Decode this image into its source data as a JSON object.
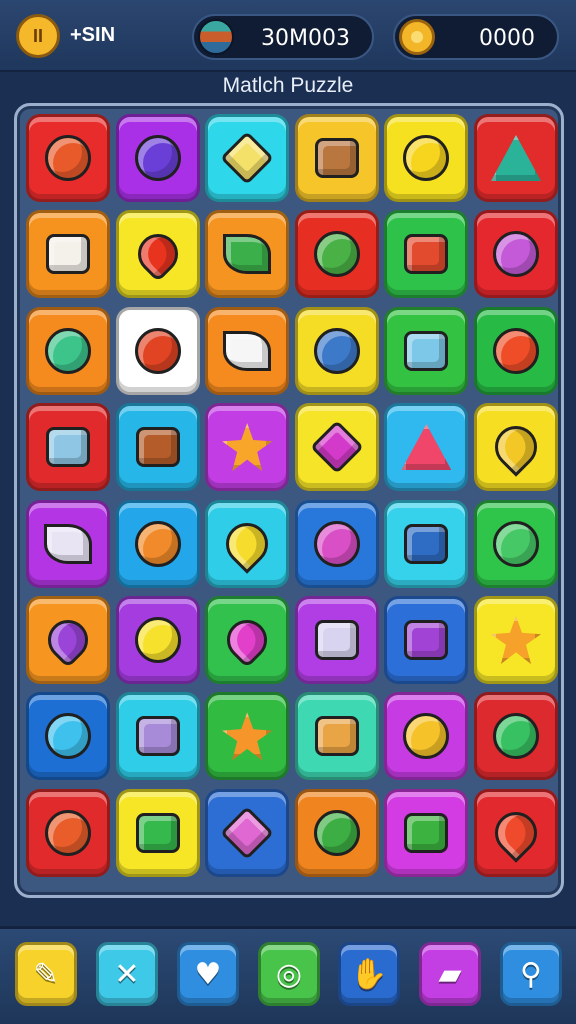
{
  "hud": {
    "pause_label": "II",
    "bonus_text": "+SIN",
    "score_value": "30M003",
    "coins_value": "0000"
  },
  "title": "Matlch Puzzle",
  "board": {
    "rows": [
      [
        {
          "name": "radish",
          "bg": "#e82c2c",
          "shape": "circle",
          "color": "#e85a2a"
        },
        {
          "name": "purple-berry",
          "bg": "#a930e6",
          "shape": "circle",
          "color": "#6a3fd8"
        },
        {
          "name": "yellow-gem",
          "bg": "#2fd7ea",
          "shape": "diamond",
          "color": "#f4e16a"
        },
        {
          "name": "box",
          "bg": "#f5c52a",
          "shape": "square",
          "color": "#b9763e"
        },
        {
          "name": "lemon",
          "bg": "#f6e120",
          "shape": "circle",
          "color": "#f7d41e"
        },
        {
          "name": "carrot",
          "bg": "#e22b2b",
          "shape": "tri",
          "color": "#2bb39a"
        }
      ],
      [
        {
          "name": "garlic",
          "bg": "#f6921e",
          "shape": "square",
          "color": "#f4f0ea"
        },
        {
          "name": "apple",
          "bg": "#f6e626",
          "shape": "heart",
          "color": "#e8341f"
        },
        {
          "name": "leaf",
          "bg": "#f59420",
          "shape": "leaf",
          "color": "#3bb04a"
        },
        {
          "name": "potted-plant",
          "bg": "#e62f22",
          "shape": "circle",
          "color": "#4ab146"
        },
        {
          "name": "meat",
          "bg": "#2fc24a",
          "shape": "square",
          "color": "#e24b2e"
        },
        {
          "name": "plum",
          "bg": "#e5282e",
          "shape": "circle",
          "color": "#c45ad8"
        }
      ],
      [
        {
          "name": "melon",
          "bg": "#f58a1e",
          "shape": "circle",
          "color": "#3cc48b"
        },
        {
          "name": "red-candy",
          "bg": "#ffffff",
          "shape": "circle",
          "color": "#e04423"
        },
        {
          "name": "feather",
          "bg": "#f58a1e",
          "shape": "leaf",
          "color": "#f6f6f6"
        },
        {
          "name": "blue-shell",
          "bg": "#f5dc25",
          "shape": "circle",
          "color": "#3d79c9"
        },
        {
          "name": "blue-device",
          "bg": "#34c243",
          "shape": "square",
          "color": "#7dc8e8"
        },
        {
          "name": "tomato",
          "bg": "#27bb45",
          "shape": "circle",
          "color": "#ee4d28"
        }
      ],
      [
        {
          "name": "camera",
          "bg": "#e02a2c",
          "shape": "square",
          "color": "#8ec6e4"
        },
        {
          "name": "brown-block",
          "bg": "#27b6e8",
          "shape": "square",
          "color": "#b45c2a"
        },
        {
          "name": "orange-star",
          "bg": "#c23de3",
          "shape": "star",
          "color": "#f7a62a"
        },
        {
          "name": "pink-gem",
          "bg": "#f6e428",
          "shape": "diamond",
          "color": "#d43ac9"
        },
        {
          "name": "pink-kite",
          "bg": "#2fb9ee",
          "shape": "tri",
          "color": "#f0466a"
        },
        {
          "name": "pineapple",
          "bg": "#f6df22",
          "shape": "drop",
          "color": "#f2c726"
        }
      ],
      [
        {
          "name": "bandage",
          "bg": "#b335e3",
          "shape": "leaf",
          "color": "#e9e4f4"
        },
        {
          "name": "orange-lolly",
          "bg": "#23a7ea",
          "shape": "circle",
          "color": "#f08a2a"
        },
        {
          "name": "yellow-drop",
          "bg": "#2fcde8",
          "shape": "drop",
          "color": "#f6dc2c"
        },
        {
          "name": "pink-flower",
          "bg": "#2878db",
          "shape": "circle",
          "color": "#d94fc6"
        },
        {
          "name": "jar",
          "bg": "#36d2ec",
          "shape": "square",
          "color": "#2f6cc4"
        },
        {
          "name": "green-bubble",
          "bg": "#2fc44a",
          "shape": "circle",
          "color": "#46c867"
        }
      ],
      [
        {
          "name": "grape",
          "bg": "#f6951f",
          "shape": "heart",
          "color": "#9a45d8"
        },
        {
          "name": "smiley",
          "bg": "#a43ce0",
          "shape": "circle",
          "color": "#f6e12c"
        },
        {
          "name": "heart",
          "bg": "#31c14c",
          "shape": "heart",
          "color": "#e23fcb"
        },
        {
          "name": "purple-box",
          "bg": "#b13ee5",
          "shape": "square",
          "color": "#d8d4f0"
        },
        {
          "name": "pencil-frame",
          "bg": "#2c6fd8",
          "shape": "square",
          "color": "#a144d6"
        },
        {
          "name": "sun",
          "bg": "#f6e626",
          "shape": "star",
          "color": "#f6a12a"
        }
      ],
      [
        {
          "name": "blue-lolly",
          "bg": "#1e6fd4",
          "shape": "circle",
          "color": "#3fc1ee"
        },
        {
          "name": "pen",
          "bg": "#2fcde8",
          "shape": "square",
          "color": "#a78bd8"
        },
        {
          "name": "orange-x",
          "bg": "#31bb41",
          "shape": "star",
          "color": "#f6952a"
        },
        {
          "name": "wood-box",
          "bg": "#3ed8b2",
          "shape": "square",
          "color": "#e9a445"
        },
        {
          "name": "yellow-apple",
          "bg": "#c73be3",
          "shape": "circle",
          "color": "#f6c22a"
        },
        {
          "name": "green-ghost",
          "bg": "#dc2a2e",
          "shape": "circle",
          "color": "#37c162"
        }
      ],
      [
        {
          "name": "red-flower",
          "bg": "#e02a2c",
          "shape": "circle",
          "color": "#e85d2a"
        },
        {
          "name": "green-bag",
          "bg": "#f6e626",
          "shape": "square",
          "color": "#35b84c"
        },
        {
          "name": "pink-crystal",
          "bg": "#2c6ed4",
          "shape": "diamond",
          "color": "#e068d2"
        },
        {
          "name": "green-bottle",
          "bg": "#f0851f",
          "shape": "circle",
          "color": "#3dae43"
        },
        {
          "name": "green-battery",
          "bg": "#d33ce3",
          "shape": "square",
          "color": "#3cb340"
        },
        {
          "name": "red-berry",
          "bg": "#e22a2e",
          "shape": "drop",
          "color": "#f04a2c"
        }
      ]
    ]
  },
  "toolbar": [
    {
      "name": "brush-tool-button",
      "bg": "#f6d22a",
      "glyph": "✎"
    },
    {
      "name": "swap-tool-button",
      "bg": "#3fc9e8",
      "glyph": "✕"
    },
    {
      "name": "heart-tool-button",
      "bg": "#2f8ee0",
      "glyph": "♥"
    },
    {
      "name": "target-tool-button",
      "bg": "#49c44a",
      "glyph": "◎"
    },
    {
      "name": "hand-tool-button",
      "bg": "#2a6bd0",
      "glyph": "✋"
    },
    {
      "name": "eraser-tool-button",
      "bg": "#c33ee3",
      "glyph": "▰"
    },
    {
      "name": "search-tool-button",
      "bg": "#2f8ee0",
      "glyph": "⚲"
    }
  ]
}
